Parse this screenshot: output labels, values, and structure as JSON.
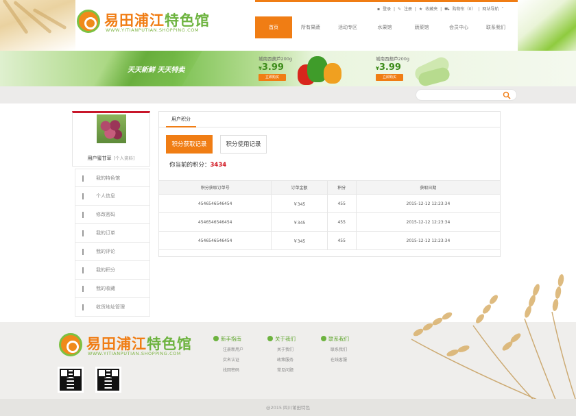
{
  "header": {
    "logo_text_a": "易田",
    "logo_text_b": "浦江",
    "logo_text_c": "特色馆",
    "logo_sub": "WWW.YITIANPUTIAN.SHOPPING.COM",
    "toplinks": [
      "登录",
      "注册",
      "收藏夹",
      "购物车（0）",
      "网站导航"
    ],
    "nav": [
      "首页",
      "所有果蔬",
      "活动专区",
      "水果馆",
      "蔬菜馆",
      "会员中心",
      "联系我们"
    ]
  },
  "banner": {
    "slogan": "天天新鲜  天天特卖",
    "promos": [
      {
        "name": "城南西葫芦200g",
        "currency": "¥",
        "price": "3.99",
        "button": "立即购买"
      },
      {
        "name": "城南西葫芦200g",
        "currency": "¥",
        "price": "3.99",
        "button": "立即购买"
      }
    ]
  },
  "search": {
    "placeholder": ""
  },
  "sidebar": {
    "username": "用户蜜甘草",
    "profile_link": "[个人资料]",
    "menu": [
      "我的特色馆",
      "个人信息",
      "修改密码",
      "我的订单",
      "我的评论",
      "我的积分",
      "我的收藏",
      "收货地址管理"
    ]
  },
  "main": {
    "tab": "用户积分",
    "btn_earn": "积分获取记录",
    "btn_use": "积分使用记录",
    "points_label": "你当前的积分：",
    "points_value": "3434",
    "table": {
      "headers": [
        "积分获取订单号",
        "订单金额",
        "积分",
        "获取日期"
      ],
      "rows": [
        [
          "4546546546454",
          "￥345",
          "455",
          "2015-12-12 12:23:34"
        ],
        [
          "4546546546454",
          "￥345",
          "455",
          "2015-12-12 12:23:34"
        ],
        [
          "4546546546454",
          "￥345",
          "455",
          "2015-12-12 12:23:34"
        ]
      ]
    }
  },
  "footer": {
    "cols": [
      {
        "title": "新手指南",
        "links": [
          "注册新用户",
          "实名认证",
          "找回密码"
        ]
      },
      {
        "title": "关于我们",
        "links": [
          "关于我们",
          "政策服务",
          "常见问题"
        ]
      },
      {
        "title": "联系我们",
        "links": [
          "联系我们",
          "在线客服"
        ]
      }
    ],
    "copyright": "@2015 四川莆田特色"
  },
  "colors": {
    "accent": "#f07d14",
    "green": "#6db33f",
    "points": "#d0121c",
    "sidebar_top": "#c8162a"
  }
}
